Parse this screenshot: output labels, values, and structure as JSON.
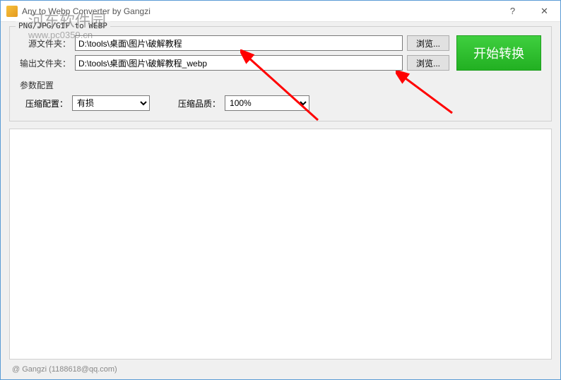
{
  "window": {
    "title": "Any to Webp Converter by Gangzi"
  },
  "group": {
    "legend": "PNG/JPG/GIF to WEBP"
  },
  "labels": {
    "source": "源文件夹：",
    "output": "输出文件夹：",
    "params": "参数配置",
    "compress_config": "压缩配置：",
    "compress_quality": "压缩品质："
  },
  "values": {
    "source_path": "D:\\tools\\桌面\\图片\\破解教程",
    "output_path": "D:\\tools\\桌面\\图片\\破解教程_webp",
    "compress_config": "有损",
    "compress_quality": "100%"
  },
  "buttons": {
    "browse": "浏览...",
    "start": "开始转换"
  },
  "statusbar": "@ Gangzi (1188618@qq.com)",
  "watermark": {
    "title": "河东软件园",
    "url": "www.pc0359.cn"
  }
}
